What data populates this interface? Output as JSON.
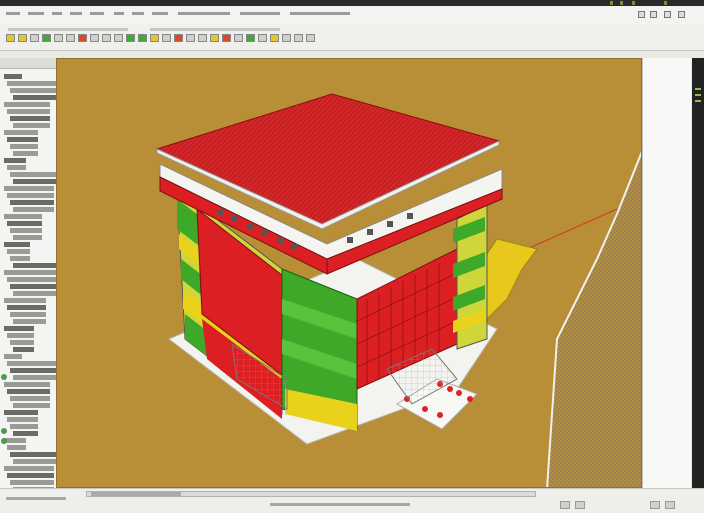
{
  "colors": {
    "roof": "#d8262a",
    "wall_red": "#dc1f22",
    "floor_green": "#3ea928",
    "floor_yellow": "#e8d21c",
    "ground": "#b88e36",
    "slab": "#f2f2ee"
  },
  "icons": {
    "menu": "window-control-icon",
    "tool": "toolbar-tool-icon",
    "tree": "tree-node-icon",
    "scroll": "scroll-arrow-icon"
  }
}
